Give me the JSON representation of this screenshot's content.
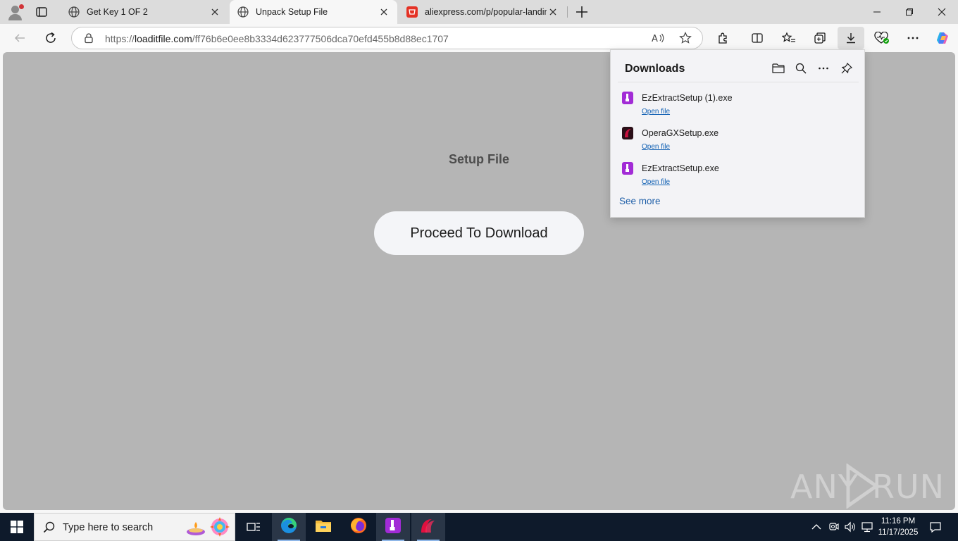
{
  "browser": {
    "tabs": [
      {
        "title": "Get Key 1 OF 2",
        "active": false
      },
      {
        "title": "Unpack Setup File",
        "active": true
      },
      {
        "title": "aliexpress.com/p/popular-landing",
        "active": false
      }
    ],
    "address": {
      "prefix": "https://",
      "domain": "loaditfile.com",
      "path": "/ff76b6e0ee8b3334d623777506dca70efd455b8d88ec1707"
    }
  },
  "page": {
    "title": "Setup File",
    "button_label": "Proceed To Download",
    "watermark": {
      "left": "ANY",
      "right": "RUN"
    }
  },
  "downloads": {
    "title": "Downloads",
    "items": [
      {
        "name": "EzExtractSetup (1).exe",
        "action": "Open file",
        "icon": "ezextract-icon"
      },
      {
        "name": "OperaGXSetup.exe",
        "action": "Open file",
        "icon": "operagx-icon"
      },
      {
        "name": "EzExtractSetup.exe",
        "action": "Open file",
        "icon": "ezextract-icon"
      }
    ],
    "see_more": "See more"
  },
  "taskbar": {
    "search_placeholder": "Type here to search",
    "time": "11:16 PM",
    "date": "11/17/2025"
  },
  "colors": {
    "page_background": "#b5b5b5",
    "taskbar": "#0e1a2b",
    "link": "#0f5fb3",
    "ezextract": "#a22bd6",
    "operagx": "#c8103e"
  }
}
